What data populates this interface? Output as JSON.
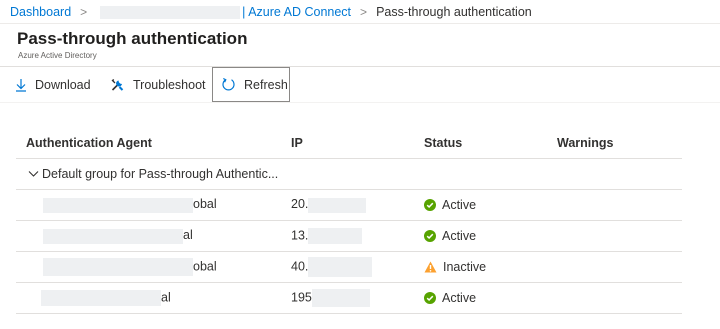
{
  "breadcrumb": {
    "dashboard": "Dashboard",
    "separator": ">",
    "azure_ad_connect": "| Azure AD Connect",
    "current": "Pass-through authentication"
  },
  "header": {
    "title": "Pass-through authentication",
    "subtitle": "Azure Active Directory"
  },
  "toolbar": {
    "download_label": "Download",
    "troubleshoot_label": "Troubleshoot",
    "refresh_label": "Refresh"
  },
  "table": {
    "columns": [
      "Authentication Agent",
      "IP",
      "Status",
      "Warnings"
    ],
    "group_label": "Default group for Pass-through Authentic...",
    "rows": [
      {
        "agent": "obal",
        "ip": "20.",
        "status": "Active",
        "warnings": ""
      },
      {
        "agent": "al",
        "ip": "13.",
        "status": "Active",
        "warnings": ""
      },
      {
        "agent": "obal",
        "ip": "40.",
        "status": "Inactive",
        "warnings": ""
      },
      {
        "agent": "al",
        "ip": "195",
        "status": "Active",
        "warnings": ""
      }
    ]
  },
  "colors": {
    "link": "#0078d4",
    "active": "#57a300",
    "inactive": "#fca130"
  },
  "icons": {
    "download": "download-icon",
    "troubleshoot": "wrench-icon",
    "refresh": "refresh-icon",
    "active": "check-circle-icon",
    "inactive": "warning-triangle-icon",
    "group": "chevron-down-icon"
  }
}
